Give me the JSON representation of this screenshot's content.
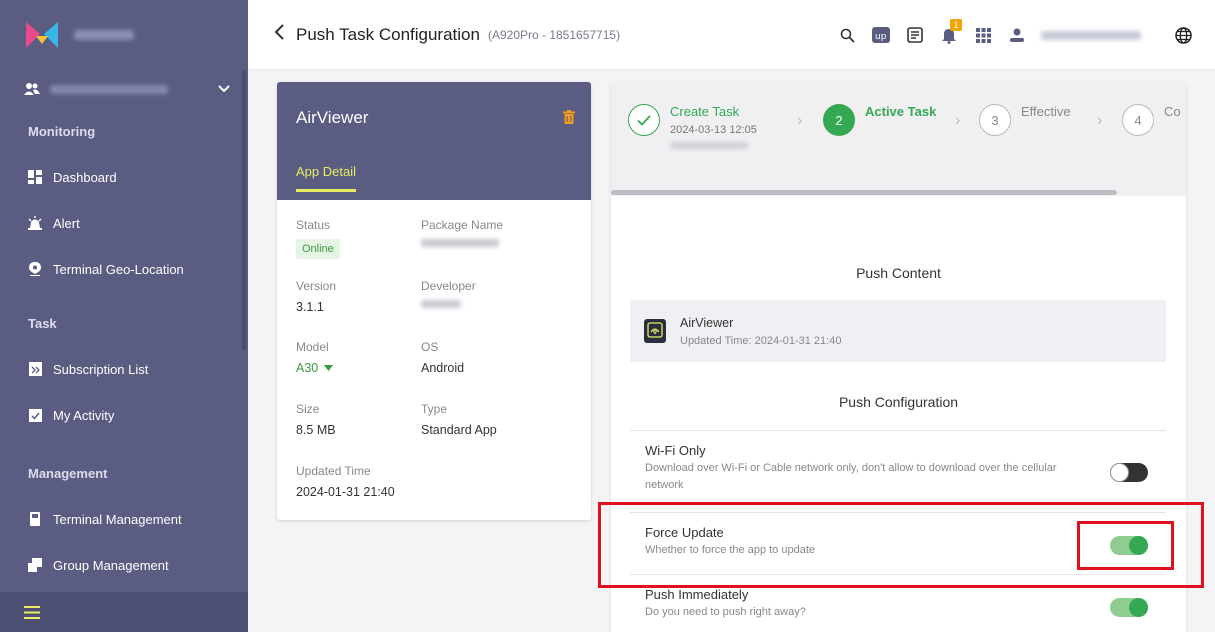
{
  "sidebar": {
    "sections": {
      "monitoring": "Monitoring",
      "task": "Task",
      "management": "Management"
    },
    "items": {
      "dashboard": "Dashboard",
      "alert": "Alert",
      "geo": "Terminal Geo-Location",
      "subscription": "Subscription List",
      "activity": "My Activity",
      "terminal": "Terminal Management",
      "group": "Group Management"
    }
  },
  "header": {
    "title": "Push Task Configuration",
    "subtitle": "(A920Pro - 1851657715)",
    "bell_count": "1"
  },
  "app": {
    "name": "AirViewer",
    "tab": "App Detail",
    "status_label": "Status",
    "status": "Online",
    "package_label": "Package Name",
    "version_label": "Version",
    "version": "3.1.1",
    "developer_label": "Developer",
    "model_label": "Model",
    "model": "A30",
    "os_label": "OS",
    "os": "Android",
    "size_label": "Size",
    "size": "8.5 MB",
    "type_label": "Type",
    "type": "Standard App",
    "updated_label": "Updated Time",
    "updated": "2024-01-31 21:40"
  },
  "steps": [
    {
      "num": "✓",
      "title": "Create Task",
      "time": "2024-03-13 12:05"
    },
    {
      "num": "2",
      "title": "Active Task"
    },
    {
      "num": "3",
      "title": "Effective"
    },
    {
      "num": "4",
      "title": "Co"
    }
  ],
  "push_content": {
    "title": "Push Content",
    "app_name": "AirViewer",
    "updated": "Updated Time: 2024-01-31 21:40"
  },
  "push_config": {
    "title": "Push Configuration",
    "wifi": {
      "title": "Wi-Fi Only",
      "desc": "Download over Wi-Fi or Cable network only, don't allow to download over the cellular network",
      "enabled": false
    },
    "force": {
      "title": "Force Update",
      "desc": "Whether to force the app to update",
      "enabled": true
    },
    "immediate": {
      "title": "Push Immediately",
      "desc": "Do you need to push right away?",
      "enabled": true
    }
  },
  "colors": {
    "sidebar": "#5a5c82",
    "accent_green": "#34a853",
    "tab_yellow": "#e6ee60",
    "highlight_red": "#e0101c"
  }
}
